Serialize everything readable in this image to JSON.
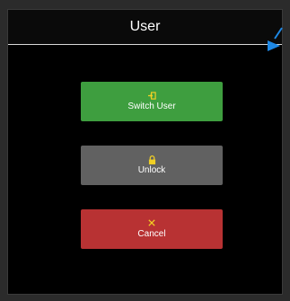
{
  "dialog": {
    "title": "User",
    "buttons": {
      "switch_user": {
        "label": "Switch User",
        "icon": "switch-user-icon",
        "icon_glyph": "⇥"
      },
      "unlock": {
        "label": "Unlock",
        "icon": "lock-icon",
        "icon_glyph": "🔒"
      },
      "cancel": {
        "label": "Cancel",
        "icon": "close-icon",
        "icon_glyph": "✕"
      }
    }
  },
  "colors": {
    "switch_user": "#3e9e3f",
    "unlock": "#616161",
    "cancel": "#b83233",
    "icon_accent": "#f2d024",
    "marker": "#1e88e5"
  }
}
